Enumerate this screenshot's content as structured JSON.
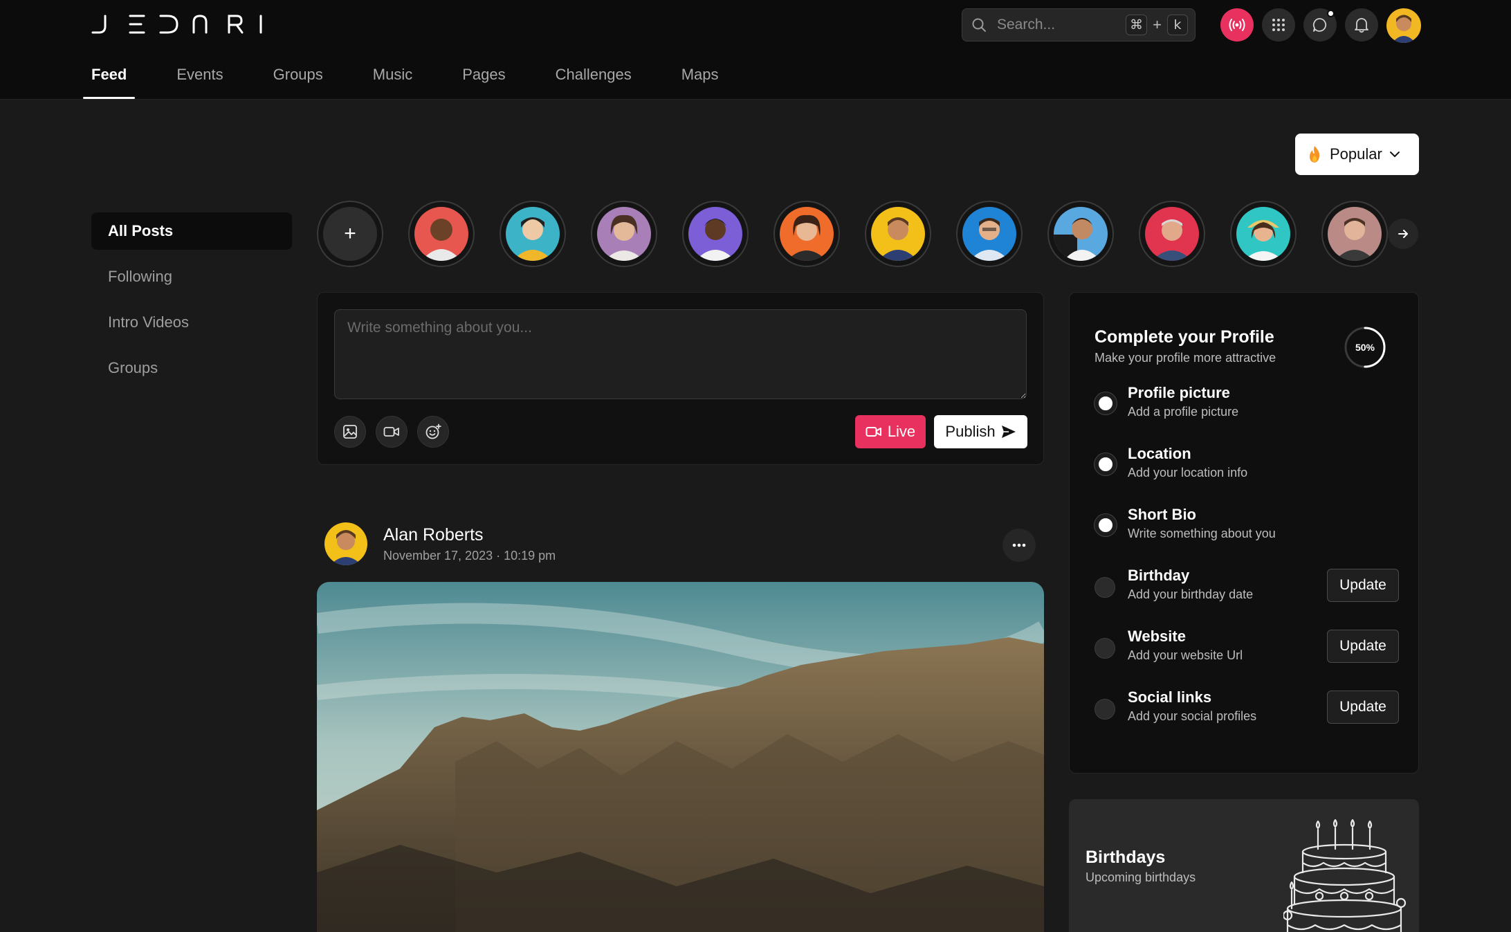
{
  "brand": {
    "logo_text": "JEDNRI"
  },
  "search": {
    "placeholder": "Search...",
    "shortcut_key_1": "⌘",
    "shortcut_plus": "+",
    "shortcut_key_2": "k"
  },
  "header_actions": {
    "live": "broadcast-icon",
    "apps": "grid-icon",
    "messages": "chat-icon",
    "notifications": "bell-icon"
  },
  "nav": {
    "tabs": [
      {
        "label": "Feed",
        "active": true
      },
      {
        "label": "Events"
      },
      {
        "label": "Groups"
      },
      {
        "label": "Music"
      },
      {
        "label": "Pages"
      },
      {
        "label": "Challenges"
      },
      {
        "label": "Maps"
      }
    ]
  },
  "filter": {
    "label": "Popular",
    "icon": "flame-icon"
  },
  "sidebar": {
    "items": [
      {
        "label": "All Posts",
        "active": true
      },
      {
        "label": "Following"
      },
      {
        "label": "Intro Videos"
      },
      {
        "label": "Groups"
      }
    ]
  },
  "stories": {
    "add_label": "+",
    "count": 11
  },
  "composer": {
    "placeholder": "Write something about you...",
    "live_label": "Live",
    "publish_label": "Publish"
  },
  "post": {
    "author": "Alan Roberts",
    "date": "November 17, 2023 · 10:19 pm"
  },
  "profile": {
    "title": "Complete your Profile",
    "subtitle": "Make your profile more attractive",
    "progress_label": "50%",
    "progress": 0.5,
    "tasks": [
      {
        "title": "Profile picture",
        "subtitle": "Add a profile picture",
        "done": true
      },
      {
        "title": "Location",
        "subtitle": "Add your location info",
        "done": true
      },
      {
        "title": "Short Bio",
        "subtitle": "Write something about you",
        "done": true
      },
      {
        "title": "Birthday",
        "subtitle": "Add your birthday date",
        "done": false,
        "action": "Update"
      },
      {
        "title": "Website",
        "subtitle": "Add your website Url",
        "done": false,
        "action": "Update"
      },
      {
        "title": "Social links",
        "subtitle": "Add your social profiles",
        "done": false,
        "action": "Update"
      }
    ]
  },
  "birthdays": {
    "title": "Birthdays",
    "subtitle": "Upcoming birthdays"
  },
  "colors": {
    "accent": "#e8315f",
    "background": "#1a1a1a",
    "header": "#0c0c0c"
  }
}
